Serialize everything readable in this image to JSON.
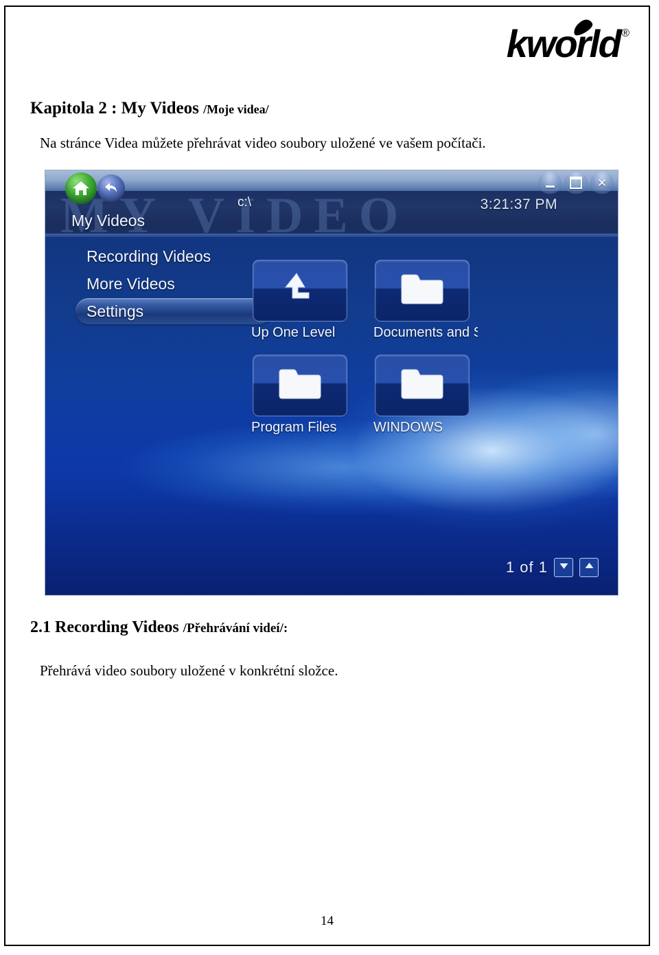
{
  "document": {
    "brand": {
      "wordmark": "kworld",
      "registered": "®"
    },
    "heading_main": "Kapitola 2 : My Videos ",
    "heading_cz": "/Moje videa/",
    "intro": "Na stránce Videa můžete přehrávat video soubory uložené ve vašem počítači.",
    "subheading_main": "2.1 Recording Videos ",
    "subheading_cz": "/Přehrávání videí/:",
    "body": "Přehrává video soubory uložené v konkrétní složce.",
    "page_number": "14"
  },
  "app": {
    "watermark": "MY VIDEO",
    "title": "My Videos",
    "path": "c:\\",
    "clock": "3:21:37 PM",
    "nav": {
      "home_icon": "home-icon",
      "back_icon": "back-arrow-icon"
    },
    "window_controls": [
      {
        "name": "minimize-button",
        "glyph": "—"
      },
      {
        "name": "maximize-button",
        "glyph": "□"
      },
      {
        "name": "close-button",
        "glyph": "✕"
      }
    ],
    "menu": [
      {
        "label": "Recording Videos",
        "selected": false
      },
      {
        "label": "More Videos",
        "selected": false
      },
      {
        "label": "Settings",
        "selected": true
      }
    ],
    "tiles": [
      {
        "label": "Up One Level",
        "icon": "up-arrow-icon"
      },
      {
        "label": "Documents and Settings",
        "icon": "folder-icon"
      },
      {
        "label": "Program Files",
        "icon": "folder-icon"
      },
      {
        "label": "WINDOWS",
        "icon": "folder-icon"
      }
    ],
    "pager": {
      "text": "1  of 1",
      "down_icon": "chevron-down-icon",
      "up_icon": "chevron-up-icon"
    },
    "colors": {
      "background_deep": "#0c2a84",
      "header_band": "#1c2f63",
      "selected_item": "#33589f",
      "home_button": "#3fae36"
    }
  }
}
